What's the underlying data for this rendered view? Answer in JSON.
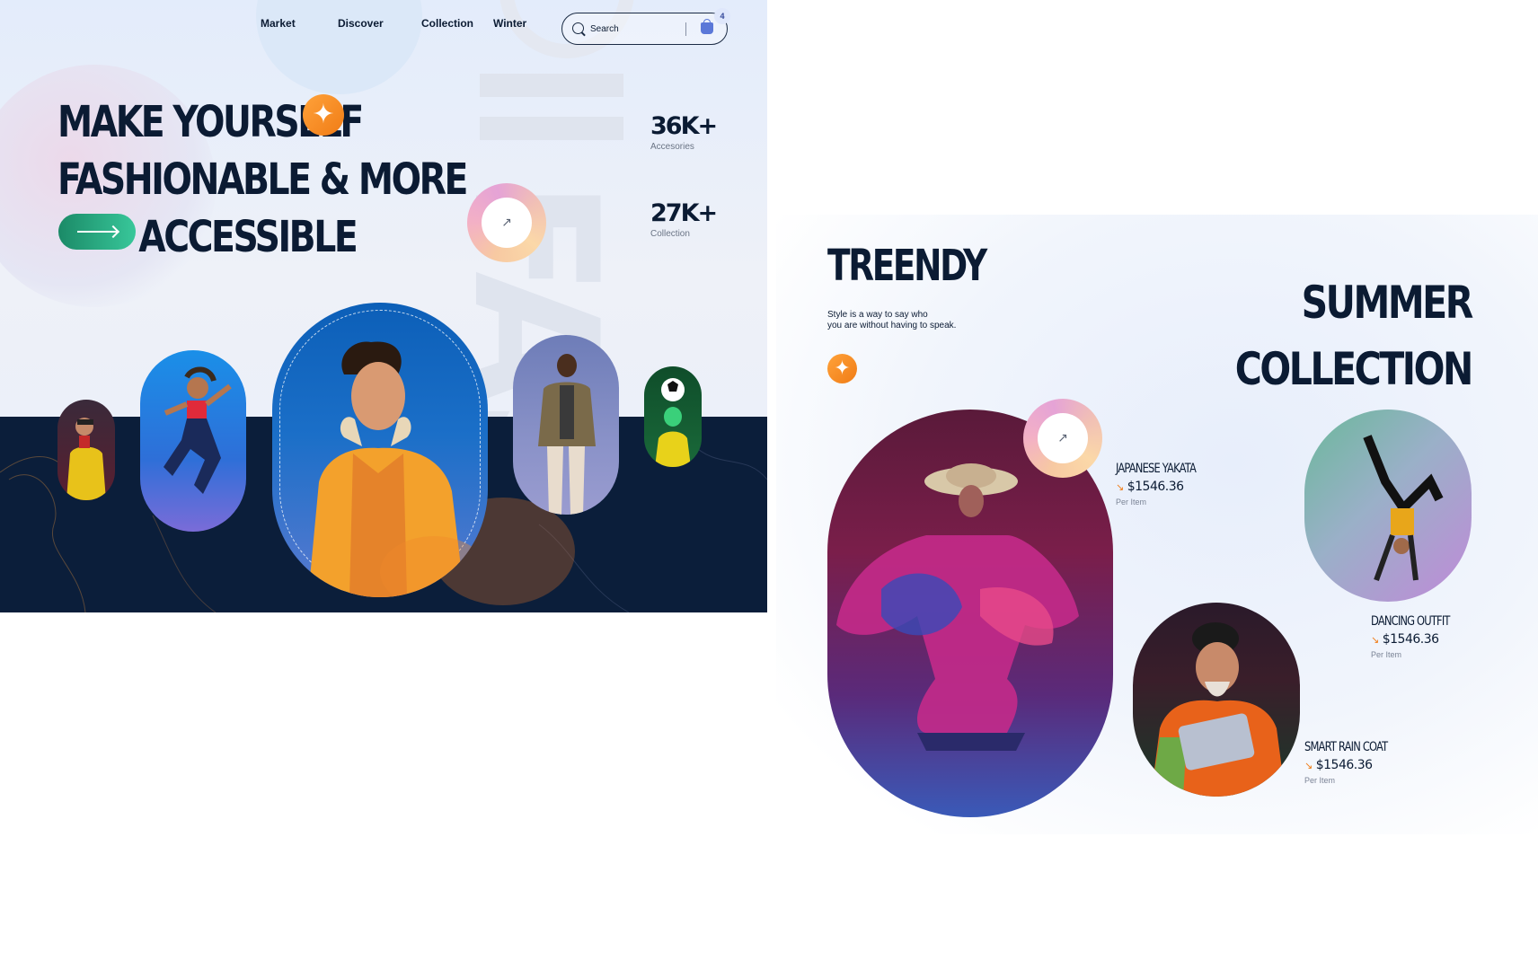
{
  "nav": {
    "items": [
      "Market",
      "Discover",
      "Collection",
      "Winter"
    ],
    "search_placeholder": "Search",
    "cart_count": "4"
  },
  "hero": {
    "headline_line1": "MAKE YOURSELF",
    "headline_line2": "FASHIONABLE & MORE",
    "headline_line3": "ACCESSIBLE",
    "background_word": "FASHION",
    "arrow_button": "↗",
    "stats": [
      {
        "value": "36K+",
        "label": "Accesories"
      },
      {
        "value": "27K+",
        "label": "Collection"
      }
    ]
  },
  "collection": {
    "title": "TREENDY",
    "tagline_line1": "Style is a way to say who",
    "tagline_line2": "you are without having to speak.",
    "heading_line1": "SUMMER",
    "heading_line2": "COLLECTION",
    "arrow_button": "↗",
    "products": [
      {
        "name": "JAPANESE YAKATA",
        "price": "$1546.36",
        "unit": "Per Item"
      },
      {
        "name": "DANCING OUTFIT",
        "price": "$1546.36",
        "unit": "Per Item"
      },
      {
        "name": "SMART RAIN COAT",
        "price": "$1546.36",
        "unit": "Per Item"
      }
    ]
  },
  "colors": {
    "navy": "#0b1e3a",
    "accent_orange": "#f07c16",
    "accent_green": "#1b8a67",
    "hero_bg": "#e3ecfb"
  },
  "icons": [
    "search-icon",
    "shopping-bag-icon",
    "sparkle-icon",
    "arrow-right-icon",
    "arrow-up-right-icon",
    "trend-down-icon"
  ]
}
